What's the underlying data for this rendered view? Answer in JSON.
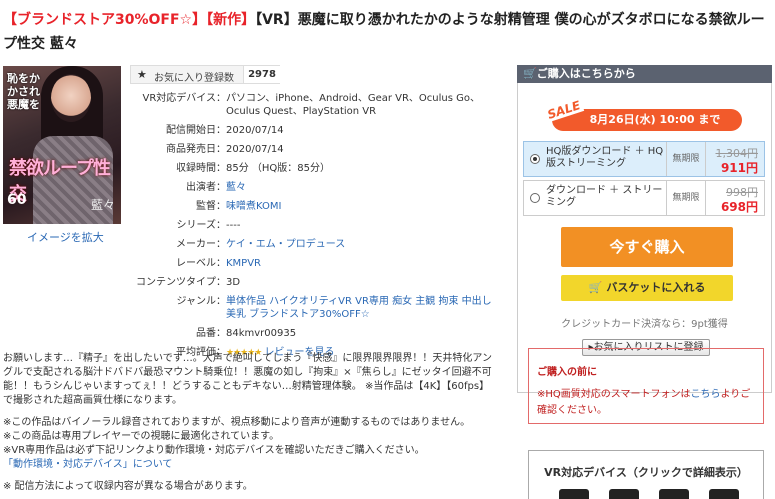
{
  "title": {
    "prefix": "【ブランドストア30%OFF☆】",
    "new_tag": "【新作】",
    "main": "【VR】悪魔に取り憑かれたかのような射精管理 僕の心がズタボロになる禁欲ループ性交 藍々"
  },
  "thumbnail": {
    "side_text": "恥をかかされ悪魔を",
    "big_text": "禁欲ループ性交",
    "sixty": "60",
    "signature": "藍々",
    "enlarge_link": "イメージを拡大"
  },
  "favorite": {
    "icon": "star-icon",
    "label": "お気に入り登録数",
    "count": "2978"
  },
  "specs": [
    {
      "key": "VR対応デバイス",
      "value": "パソコン、iPhone、Android、Gear VR、Oculus Go、Oculus Quest、PlayStation VR",
      "link": false
    },
    {
      "key": "配信開始日",
      "value": "2020/07/14",
      "link": false
    },
    {
      "key": "商品発売日",
      "value": "2020/07/14",
      "link": false
    },
    {
      "key": "収録時間",
      "value": "85分 （HQ版：85分）",
      "link": false
    },
    {
      "key": "出演者",
      "value": "藍々",
      "link": true
    },
    {
      "key": "監督",
      "value": "味噌煮KOMI",
      "link": true
    },
    {
      "key": "シリーズ",
      "value": "----",
      "link": false
    },
    {
      "key": "メーカー",
      "value": "ケイ・エム・プロデュース",
      "link": true
    },
    {
      "key": "レーベル",
      "value": "KMPVR",
      "link": true
    },
    {
      "key": "コンテンツタイプ",
      "value": "3D",
      "link": false
    },
    {
      "key": "ジャンル",
      "value": "単体作品 ハイクオリティVR VR専用 痴女 主観 拘束 中出し 美乳 ブランドストア30%OFF☆",
      "link": true
    },
    {
      "key": "品番",
      "value": "84kmvr00935",
      "link": false
    },
    {
      "key": "平均評価",
      "stars": "★★★★★",
      "value": "レビューを見る",
      "link": true
    }
  ],
  "description": {
    "p1": "お願いします…『精子』を出したいです…。大声で絶叫してしまう『快感』に限界限界限界！！天井特化アングルで支配される脳汁ドバドバ最恐マウント騎乗位！！悪魔の如し『拘束』×『焦らし』にゼッタイ回避不可能！！もうシんじゃいますってぇ！！どうすることもデキない…射精管理体験。 ※当作品は【4K】【60fps】で撮影された超高画質仕様になります。",
    "p2a": "※この作品はバイノーラル録音されておりますが、視点移動により音声が連動するものではありません。",
    "p2b": "※この商品は専用プレイヤーでの視聴に最適化されています。",
    "p2c": "※VR専用作品は必ず下記リンクより動作環境・対応デバイスを確認いただきご購入ください。",
    "p2d": "「動作環境・対応デバイス」について",
    "p3": "※ 配信方法によって収録内容が異なる場合があります。"
  },
  "purchase": {
    "header": "ご購入はこちらから",
    "sale_tag": "SALE",
    "sale_text": "8月26日(水) 10:00 まで",
    "options": [
      {
        "name": "HQ版ダウンロード ＋ HQ版ストリーミング",
        "limit": "無期限",
        "old_price": "1,304円",
        "new_price": "911円",
        "selected": true
      },
      {
        "name": "ダウンロード ＋ ストリーミング",
        "limit": "無期限",
        "old_price": "998円",
        "new_price": "698円",
        "selected": false
      }
    ],
    "buy_now": "今すぐ購入",
    "cart_icon": "cart-icon",
    "add_to_cart": "バスケットに入れる",
    "credit": "クレジットカード決済なら：9pt獲得",
    "wishlist": "お気に入りリストに登録"
  },
  "notice": {
    "heading": "ご購入の前に",
    "body_pre": "※HQ画質対応のスマートフォンは",
    "body_link": "こちら",
    "body_post": "よりご確認ください。"
  },
  "vr_devices": {
    "heading": "VR対応デバイス（クリックで詳細表示）"
  },
  "colors": {
    "accent_red": "#e8232a",
    "link_blue": "#2a68b4",
    "buy_orange": "#f29024",
    "cart_yellow": "#f2d62b",
    "sale_orange": "#f25a2b"
  }
}
